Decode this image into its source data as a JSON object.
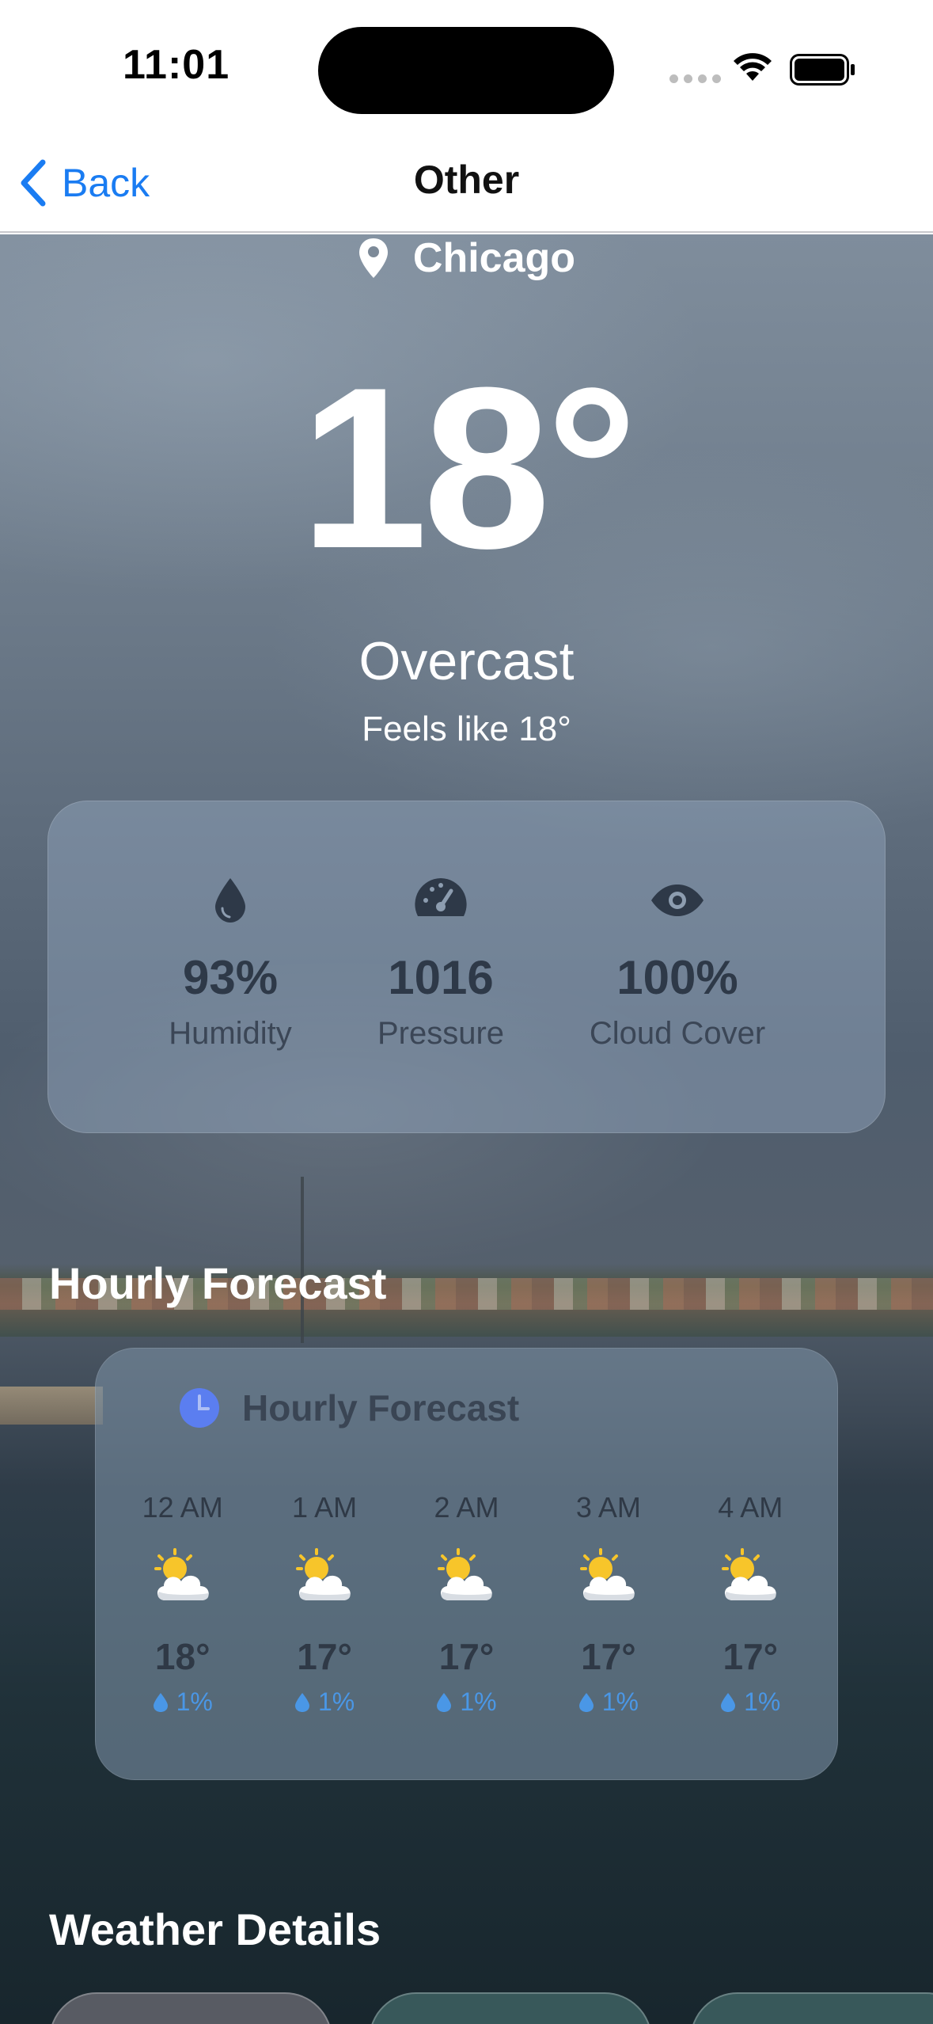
{
  "status_bar": {
    "time": "11:01"
  },
  "nav": {
    "back_label": "Back",
    "title": "Other"
  },
  "weather": {
    "city": "Chicago",
    "temperature": "18°",
    "condition": "Overcast",
    "feels_like": "Feels like 18°",
    "stats": [
      {
        "icon": "droplet-icon",
        "value": "93%",
        "label": "Humidity"
      },
      {
        "icon": "gauge-icon",
        "value": "1016",
        "label": "Pressure"
      },
      {
        "icon": "eye-icon",
        "value": "100%",
        "label": "Cloud Cover"
      }
    ]
  },
  "hourly": {
    "section_title": "Hourly Forecast",
    "card_title": "Hourly Forecast",
    "hours": [
      {
        "time": "12 AM",
        "icon": "partly-cloudy-icon",
        "temp": "18°",
        "precip": "1%"
      },
      {
        "time": "1 AM",
        "icon": "partly-cloudy-icon",
        "temp": "17°",
        "precip": "1%"
      },
      {
        "time": "2 AM",
        "icon": "partly-cloudy-icon",
        "temp": "17°",
        "precip": "1%"
      },
      {
        "time": "3 AM",
        "icon": "partly-cloudy-icon",
        "temp": "17°",
        "precip": "1%"
      },
      {
        "time": "4 AM",
        "icon": "partly-cloudy-icon",
        "temp": "17°",
        "precip": "1%"
      }
    ]
  },
  "details": {
    "section_title": "Weather Details"
  },
  "colors": {
    "accent": "#1a7cf2",
    "precip": "#4a97e6",
    "clock": "#5b7ef0"
  }
}
